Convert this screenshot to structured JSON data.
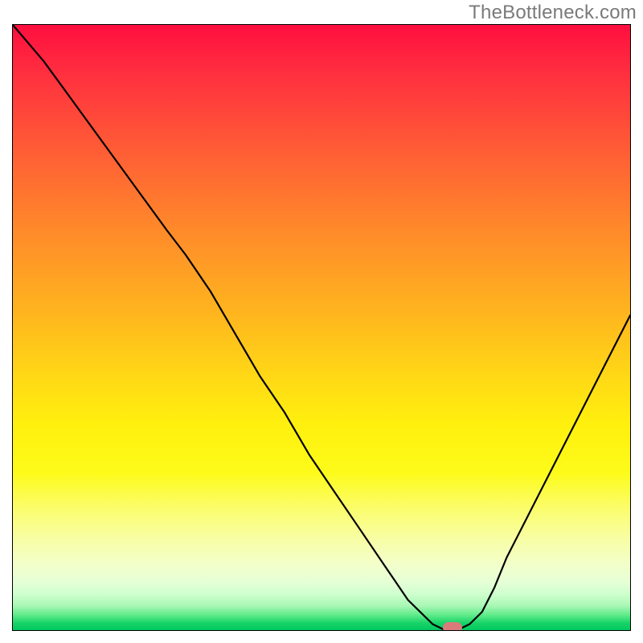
{
  "watermark": "TheBottleneck.com",
  "chart_data": {
    "type": "line",
    "title": "",
    "xlabel": "",
    "ylabel": "",
    "xlim": [
      0,
      100
    ],
    "ylim": [
      0,
      100
    ],
    "grid": false,
    "legend": false,
    "series": [
      {
        "name": "bottleneck-curve",
        "x": [
          0,
          5,
          10,
          15,
          20,
          25,
          28,
          32,
          36,
          40,
          44,
          48,
          52,
          56,
          60,
          62,
          64,
          66,
          68,
          70,
          72,
          74,
          76,
          78,
          80,
          84,
          88,
          92,
          96,
          100
        ],
        "y": [
          100,
          94,
          87,
          80,
          73,
          66,
          62,
          56,
          49,
          42,
          36,
          29,
          23,
          17,
          11,
          8,
          5,
          3,
          1,
          0,
          0,
          1,
          3,
          7,
          12,
          20,
          28,
          36,
          44,
          52
        ]
      }
    ],
    "marker": {
      "x": 71,
      "y": 0,
      "shape": "pill",
      "color": "#d97b7b"
    },
    "background": {
      "type": "vertical-gradient",
      "stops": [
        {
          "pos": 0.0,
          "color": "#ff0e3f"
        },
        {
          "pos": 0.34,
          "color": "#ff8a2a"
        },
        {
          "pos": 0.66,
          "color": "#fff00e"
        },
        {
          "pos": 0.89,
          "color": "#f3ffc9"
        },
        {
          "pos": 1.0,
          "color": "#00c85e"
        }
      ]
    }
  }
}
